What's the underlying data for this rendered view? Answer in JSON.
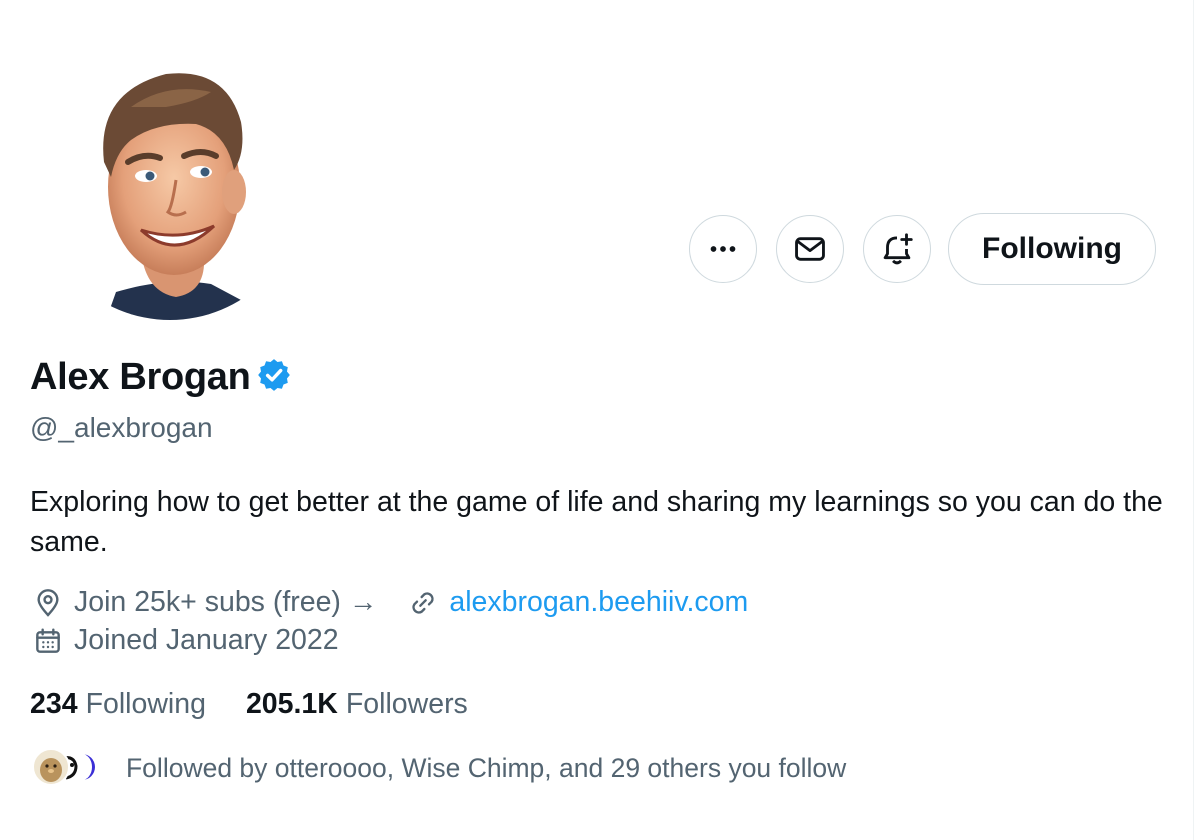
{
  "profile": {
    "display_name": "Alex Brogan",
    "handle": "@_alexbrogan",
    "bio": "Exploring how to get better at the game of life and sharing my learnings so you can do the same.",
    "location": "Join 25k+ subs (free) →",
    "website": "alexbrogan.beehiiv.com",
    "joined": "Joined January 2022",
    "verified": true
  },
  "actions": {
    "more_icon": "more-horizontal-icon",
    "message_icon": "envelope-icon",
    "notify_icon": "bell-plus-icon",
    "following_label": "Following"
  },
  "stats": {
    "following_count": "234",
    "following_label": "Following",
    "followers_count": "205.1K",
    "followers_label": "Followers"
  },
  "followed_by": {
    "text": "Followed by otteroooo, Wise Chimp, and 29 others you follow"
  },
  "colors": {
    "accent": "#1d9bf0",
    "secondary_text": "#536471",
    "border": "#cfd9de"
  }
}
